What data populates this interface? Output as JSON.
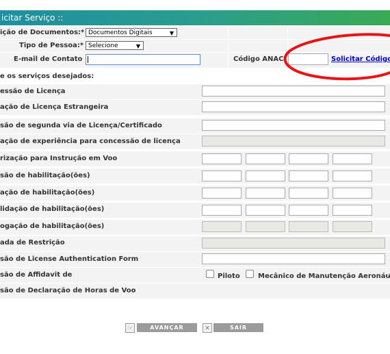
{
  "header": {
    "title": "icitar Serviço ::"
  },
  "form": {
    "doc_label": "ição de Documentos:*",
    "doc_value": "Documentos Digitais",
    "person_label": "Tipo de Pessoa:*",
    "person_value": "Selecione",
    "email_label": "E-mail de Contato",
    "email_value": "",
    "anac_label": "Código ANAC",
    "anac_value": "",
    "request_code": "Solicitar Código",
    "services_header": "e os serviços desejados:"
  },
  "services": [
    "essão de Licença",
    "ação de Licença Estrangeira",
    "são de segunda via de Licença/Certificado",
    "ação de experiência para concessão de licença",
    "rização para Instrução em Voo",
    "são de habilitação(ões)",
    "ação de habilitação(ões)",
    "lidação de habilitação(ões)",
    "ogação de habilitação(ões)",
    "ada de Restrição",
    "são de License Authentication Form",
    "são de Affidavit de",
    "são de Declaração de Horas de Voo"
  ],
  "affidavit": {
    "pilot": "Piloto",
    "mechanic": "Mecânico de Manutenção Aeronáut"
  },
  "buttons": {
    "next": "AVANÇAR",
    "exit": "SAIR"
  },
  "annotation_color": "#e8141a"
}
